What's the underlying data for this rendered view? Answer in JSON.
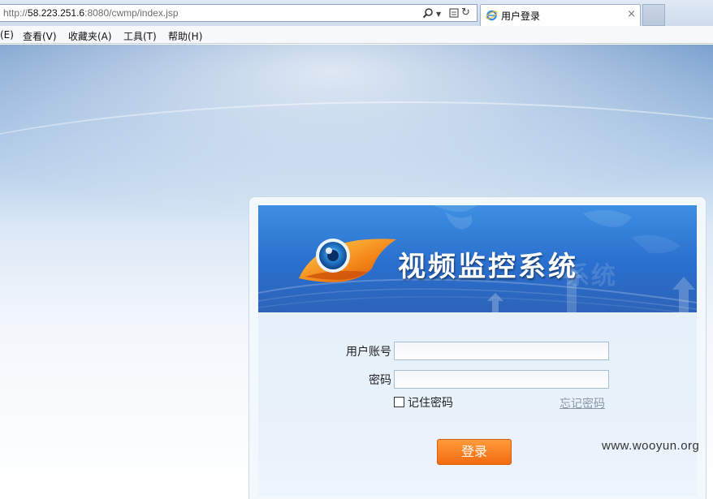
{
  "browser": {
    "url_prefix": "http://",
    "url_host": "58.223.251.6",
    "url_rest": ":8080/cwmp/index.jsp",
    "search_icon": "search-icon",
    "tab_title": "用户登录",
    "tab_close": "×"
  },
  "menubar": {
    "items": [
      "(E)",
      "查看(V)",
      "收藏夹(A)",
      "工具(T)",
      "帮助(H)"
    ]
  },
  "banner": {
    "title": "视频监控系统",
    "ghost": "系统"
  },
  "form": {
    "account_label": "用户账号",
    "account_value": "",
    "password_label": "密码",
    "password_value": "",
    "remember_label": "记住密码",
    "remember_checked": false,
    "forgot_label": "忘记密码",
    "submit_label": "登录"
  },
  "watermark": "www.wooyun.org",
  "colors": {
    "accent_orange": "#f36b0e",
    "banner_blue": "#2a6fce"
  }
}
